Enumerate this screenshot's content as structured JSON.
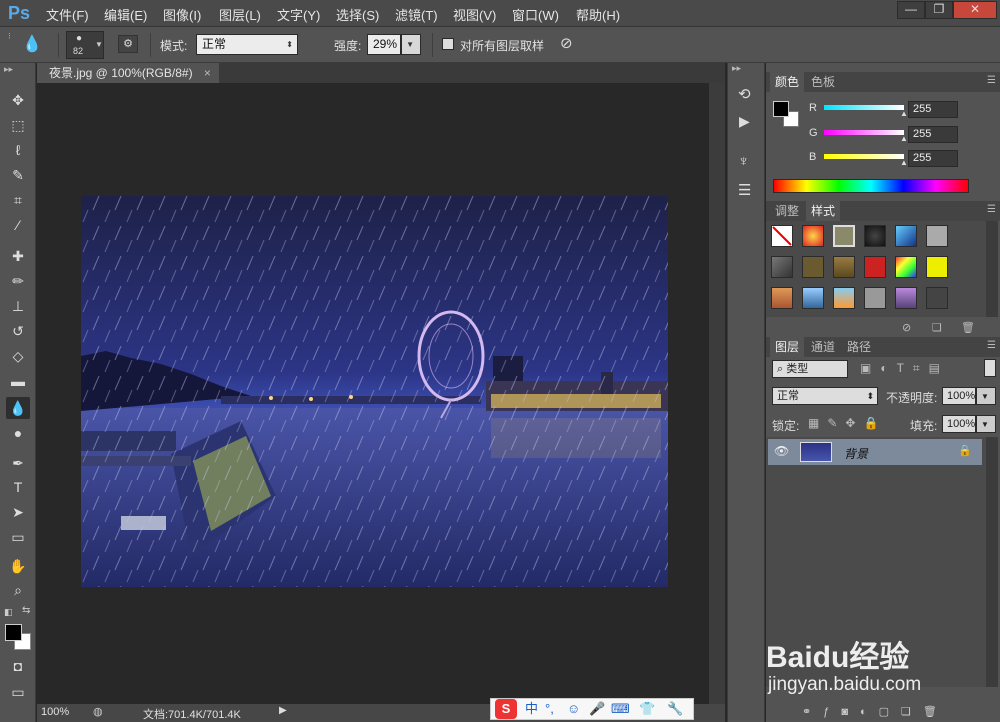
{
  "menubar": {
    "logo": "Ps",
    "items": [
      "文件(F)",
      "编辑(E)",
      "图像(I)",
      "图层(L)",
      "文字(Y)",
      "选择(S)",
      "滤镜(T)",
      "视图(V)",
      "窗口(W)",
      "帮助(H)"
    ],
    "window_buttons": [
      "—",
      "❐",
      "✕"
    ]
  },
  "options": {
    "brush_size": "82",
    "mode_label": "模式:",
    "mode_value": "正常",
    "strength_label": "强度:",
    "strength_value": "29%",
    "sample_all_label": "对所有图层取样"
  },
  "document": {
    "tab_title": "夜景.jpg @ 100%(RGB/8#)",
    "tab_close": "×",
    "zoom": "100%",
    "doc_info": "文档:701.4K/701.4K"
  },
  "color_panel": {
    "tabs": [
      "颜色",
      "色板"
    ],
    "channels": [
      {
        "name": "R",
        "value": "255",
        "color": "#00e5ff"
      },
      {
        "name": "G",
        "value": "255",
        "color": "#ff00ff"
      },
      {
        "name": "B",
        "value": "255",
        "color": "#ffff00"
      }
    ]
  },
  "styles_panel": {
    "tabs": [
      "调整",
      "样式"
    ]
  },
  "layers_panel": {
    "tabs": [
      "图层",
      "通道",
      "路径"
    ],
    "filter_label": "类型",
    "blend_mode": "正常",
    "opacity_label": "不透明度:",
    "opacity_value": "100%",
    "lock_label": "锁定:",
    "fill_label": "填充:",
    "fill_value": "100%",
    "layers": [
      {
        "name": "背景",
        "visible": true,
        "locked": true
      }
    ]
  },
  "ime": {
    "items": [
      "中",
      "°,",
      "☺",
      "🎤",
      "⌨",
      "👕",
      "🔧"
    ]
  },
  "watermark": {
    "brand": "Baidu经验",
    "url": "jingyan.baidu.com"
  },
  "colors": {
    "accent": "#5ba9e6",
    "layer_selected": "#7d8a9c"
  }
}
